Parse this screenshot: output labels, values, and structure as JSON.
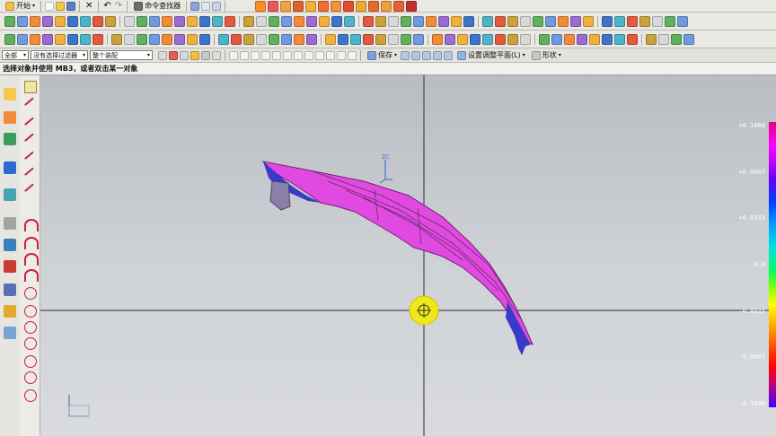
{
  "toolbar": {
    "start_label": "开始",
    "command_finder_label": "命令查找器"
  },
  "filter_bar": {
    "scope_value": "全部",
    "type_filter_value": "没有选择过滤器",
    "assembly_value": "整个装配",
    "save_label": "保存",
    "work_plane_label": "设置调整平面(L)",
    "shape_label": "形状"
  },
  "status": {
    "prompt": "选择对象并使用 MB3，或者双击某一对象"
  },
  "legend": {
    "labels": [
      "+0.1000",
      "+0.0667",
      "+0.0333",
      "0.0",
      "-0.0333",
      "-0.0667",
      "-0.1000"
    ]
  },
  "axes": {
    "triad_label": "ZC"
  },
  "colors": {
    "part": "#e04ae0",
    "part_edge": "#7a1f7a",
    "part_shadow": "#3a3ac8",
    "cursor": "#f0e81a"
  }
}
